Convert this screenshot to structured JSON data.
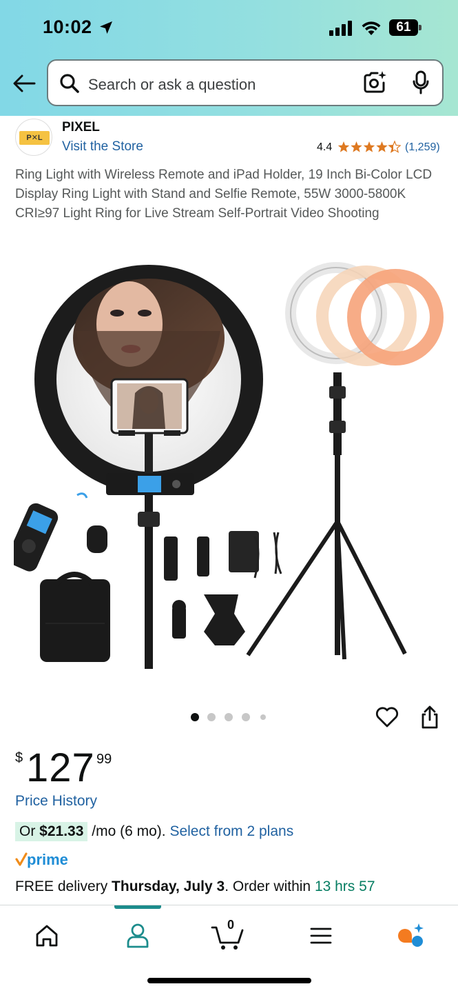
{
  "status_bar": {
    "time": "10:02",
    "battery": "61"
  },
  "search": {
    "placeholder": "Search or ask a question"
  },
  "store": {
    "logo_text": "P✕L",
    "name": "PIXEL",
    "link": "Visit the Store",
    "rating": "4.4",
    "rating_value": 4.4,
    "review_count": "(1,259)"
  },
  "product": {
    "title": "Ring Light with Wireless Remote and iPad Holder, 19 Inch Bi-Color LCD Display Ring Light with Stand and Selfie Remote, 55W 3000-5800K CRI≥97 Light Ring for Live Stream Self-Portrait Video Shooting",
    "image_count": 5,
    "active_image": 1
  },
  "price": {
    "currency": "$",
    "whole": "127",
    "fraction": "99",
    "history_link": "Price History"
  },
  "installment": {
    "prefix": "Or ",
    "amount": "$21.33",
    "term": " /mo (6 mo). ",
    "link": "Select from 2 plans"
  },
  "prime": {
    "label": "prime"
  },
  "delivery": {
    "free_text": "FREE delivery ",
    "date": "Thursday, July 3",
    "order_text": ". Order within ",
    "countdown": "13 hrs 57"
  },
  "bottom_nav": {
    "cart_count": "0",
    "items": [
      "home",
      "account",
      "cart",
      "menu",
      "rufus"
    ],
    "active": "account"
  },
  "colors": {
    "link": "#2162a1",
    "star": "#de7921",
    "green": "#067d62",
    "teal_active": "#1c8c8c"
  }
}
